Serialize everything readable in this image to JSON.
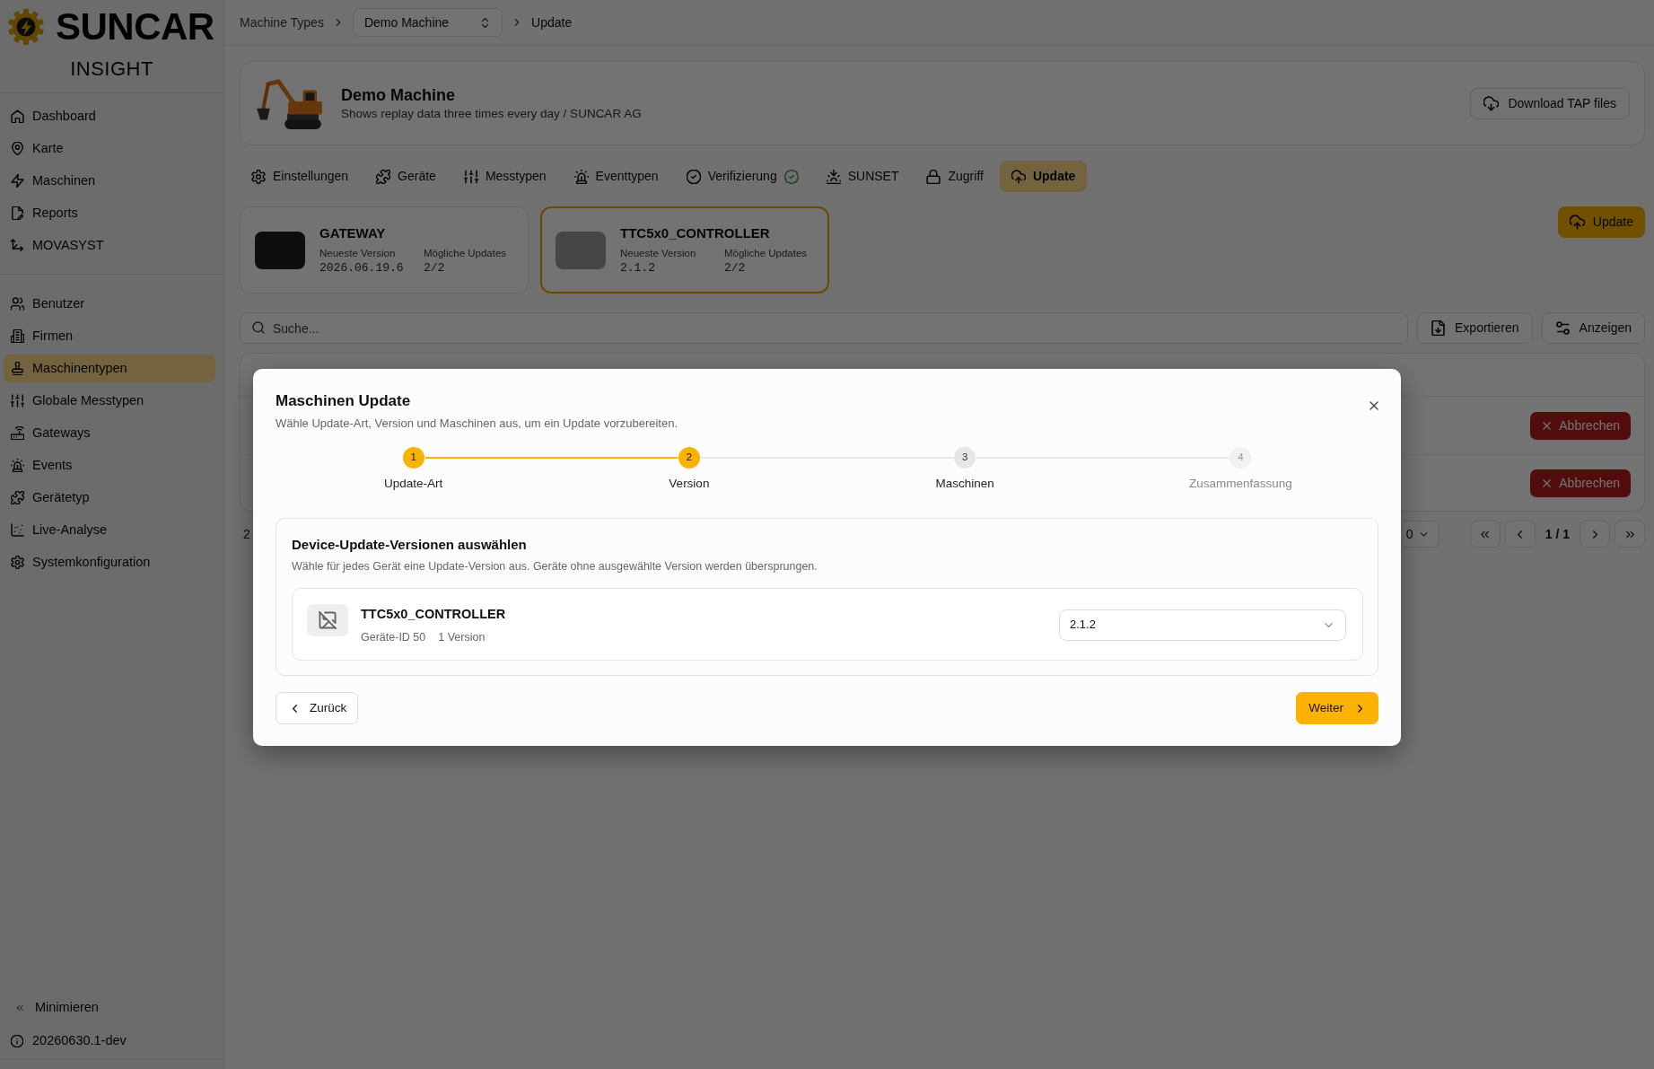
{
  "sidebar": {
    "logo": {
      "brand": "SUNCAR",
      "product": "INSIGHT"
    },
    "sections": [
      {
        "items": [
          {
            "label": "Dashboard",
            "selected": false
          },
          {
            "label": "Karte",
            "selected": false
          },
          {
            "label": "Maschinen",
            "selected": false
          },
          {
            "label": "Reports",
            "selected": false
          },
          {
            "label": "MOVASYST",
            "selected": false
          }
        ]
      },
      {
        "items": [
          {
            "label": "Benutzer",
            "selected": false
          },
          {
            "label": "Firmen",
            "selected": false
          },
          {
            "label": "Maschinentypen",
            "selected": true
          },
          {
            "label": "Globale Messtypen",
            "selected": false
          },
          {
            "label": "Gateways",
            "selected": false
          },
          {
            "label": "Events",
            "selected": false
          },
          {
            "label": "Gerätetyp",
            "selected": false
          },
          {
            "label": "Live-Analyse",
            "selected": false
          },
          {
            "label": "Systemkonfiguration",
            "selected": false
          }
        ]
      }
    ],
    "collapse": "Minimieren",
    "version": "20260630.1-dev"
  },
  "breadcrumb": [
    {
      "label": "Machine Types",
      "kind": "link"
    },
    {
      "label": "Demo Machine",
      "kind": "select"
    },
    {
      "label": "Update",
      "kind": "current"
    }
  ],
  "machine": {
    "name": "Demo Machine",
    "description": "Shows replay data three times every day / SUNCAR AG",
    "download_button": "Download TAP files"
  },
  "tabs": [
    {
      "label": "Einstellungen",
      "selected": false,
      "verified": false
    },
    {
      "label": "Geräte",
      "selected": false,
      "verified": false
    },
    {
      "label": "Messtypen",
      "selected": false,
      "verified": false
    },
    {
      "label": "Eventtypen",
      "selected": false,
      "verified": false
    },
    {
      "label": "Verifizierung",
      "selected": false,
      "verified": true
    },
    {
      "label": "SUNSET",
      "selected": false,
      "verified": false
    },
    {
      "label": "Zugriff",
      "selected": false,
      "verified": false
    },
    {
      "label": "Update",
      "selected": true,
      "verified": false
    }
  ],
  "devices": [
    {
      "name": "GATEWAY",
      "latest_label": "Neueste Version",
      "latest_version": "2026.06.19.6",
      "updates_label": "Mögliche Updates",
      "updates": "2/2",
      "selected": false
    },
    {
      "name": "TTC5x0_CONTROLLER",
      "latest_label": "Neueste Version",
      "latest_version": "2.1.2",
      "updates_label": "Mögliche Updates",
      "updates": "2/2",
      "selected": true
    }
  ],
  "update_button": "Update",
  "toolbar": {
    "search": {
      "placeholder": "Suche..."
    },
    "export_button": "Exportieren",
    "view_button": "Anzeigen"
  },
  "table": {
    "rows": [
      {
        "action": "Abbrechen"
      },
      {
        "action": "Abbrechen"
      }
    ]
  },
  "pagination": {
    "count": "2",
    "page_size": "0",
    "page": "1 / 1"
  },
  "modal": {
    "title": "Maschinen Update",
    "subtitle": "Wähle Update-Art, Version und Maschinen aus, um ein Update vorzubereiten.",
    "steps": [
      {
        "number": "1",
        "label": "Update-Art",
        "reached": true,
        "disabled": false
      },
      {
        "number": "2",
        "label": "Version",
        "reached": true,
        "disabled": false
      },
      {
        "number": "3",
        "label": "Maschinen",
        "reached": false,
        "disabled": false
      },
      {
        "number": "4",
        "label": "Zusammenfassung",
        "reached": false,
        "disabled": true
      }
    ],
    "section": {
      "title": "Device-Update-Versionen auswählen",
      "description": "Wähle für jedes Gerät eine Update-Version aus. Geräte ohne ausgewählte Version werden übersprungen.",
      "devices": [
        {
          "name": "TTC5x0_CONTROLLER",
          "device_id": "Geräte-ID 50",
          "version_count": "1 Version",
          "version": "2.1.2"
        }
      ]
    },
    "back_button": "Zurück",
    "next_button": "Weiter"
  }
}
